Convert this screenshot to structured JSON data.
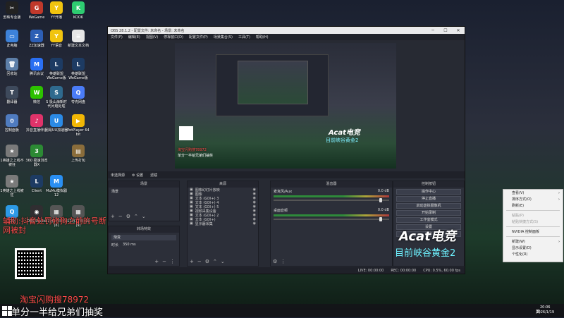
{
  "desktop": {
    "icons": [
      {
        "label": "剪映专业版",
        "glyph": "✂",
        "color": "#222222",
        "name": "capcut-icon"
      },
      {
        "label": "WeGame",
        "glyph": "G",
        "color": "#c0392b",
        "name": "wegame-icon"
      },
      {
        "label": "YY开播",
        "glyph": "Y",
        "color": "#f1c40f",
        "name": "yy-live-icon"
      },
      {
        "label": "KOOK",
        "glyph": "K",
        "color": "#2ecc71",
        "name": "kook-icon"
      },
      {
        "label": "此电脑",
        "glyph": "▭",
        "color": "#3d82d9",
        "name": "this-pc-icon"
      },
      {
        "label": "ZZ加速器",
        "glyph": "Z",
        "color": "#2d5fb5",
        "name": "zz-accelerator-icon"
      },
      {
        "label": "YY语音",
        "glyph": "Y",
        "color": "#f1c40f",
        "name": "yy-voice-icon"
      },
      {
        "label": "新建文本文档",
        "glyph": "≡",
        "color": "#e6e6e6",
        "name": "text-doc-icon"
      },
      {
        "label": "回收站",
        "glyph": "🗑",
        "color": "#5d7fa8",
        "name": "recycle-bin-icon"
      },
      {
        "label": "腾讯会议",
        "glyph": "M",
        "color": "#2a6ff2",
        "name": "tencent-meeting-icon"
      },
      {
        "label": "英雄联盟WeGame版",
        "glyph": "L",
        "color": "#1d3b63",
        "name": "lol-wegame-icon"
      },
      {
        "label": "英雄联盟WeGame版",
        "glyph": "L",
        "color": "#1d3b63",
        "name": "lol-wegame-2-icon"
      },
      {
        "label": "翻译器",
        "glyph": "T",
        "color": "#3e4a5c",
        "name": "translator-icon"
      },
      {
        "label": "微信",
        "glyph": "W",
        "color": "#2dc100",
        "name": "wechat-icon"
      },
      {
        "label": "S 极山海新时代问题处理",
        "glyph": "S",
        "color": "#2f6a8e",
        "name": "doc-icon"
      },
      {
        "label": "夸克网盘",
        "glyph": "Q",
        "color": "#4a7cf7",
        "name": "quark-icon"
      },
      {
        "label": "控制面板",
        "glyph": "⚙",
        "color": "#4f7bbf",
        "name": "control-panel-icon"
      },
      {
        "label": "抖音直播伴侣",
        "glyph": "♪",
        "color": "#e0336a",
        "name": "douyin-icon"
      },
      {
        "label": "网易UU加速器",
        "glyph": "U",
        "color": "#2b8ae6",
        "name": "uu-icon"
      },
      {
        "label": "PotPlayer 64 bit",
        "glyph": "▶",
        "color": "#f2b705",
        "name": "potplayer-icon"
      },
      {
        "label": "1英雄之上线不被狂",
        "glyph": "★",
        "color": "#7a7a7a",
        "name": "shortcut-icon"
      },
      {
        "label": "360 极速浏览器X",
        "glyph": "3",
        "color": "#2c8a34",
        "name": "360-icon"
      },
      {
        "label": "",
        "glyph": "",
        "color": "#333333",
        "name": "blank-icon"
      },
      {
        "label": "上传打包",
        "glyph": "▤",
        "color": "#8a6d3b",
        "name": "folder-icon"
      },
      {
        "label": "1英雄之上线被狂",
        "glyph": "★",
        "color": "#7a7a7a",
        "name": "shortcut-2-icon"
      },
      {
        "label": "Client",
        "glyph": "L",
        "color": "#1d3b63",
        "name": "lol-client-icon"
      },
      {
        "label": "MuMu模拟器12",
        "glyph": "M",
        "color": "#2a8ff2",
        "name": "mumu-icon"
      },
      {
        "label": "",
        "glyph": "",
        "color": "#333333",
        "name": "blank-2-icon"
      },
      {
        "label": "QQ",
        "glyph": "Q",
        "color": "#2d9ae6",
        "name": "qq-icon"
      },
      {
        "label": "OBS Studio",
        "glyph": "◉",
        "color": "#302e31",
        "name": "obs-icon"
      },
      {
        "label": "12月17日 (1)(8)",
        "glyph": "▦",
        "color": "#555555",
        "name": "video-file-icon"
      },
      {
        "label": "12月17日 (1)(9)",
        "glyph": "▦",
        "color": "#555555",
        "name": "video-file-2-icon"
      }
    ]
  },
  "obs": {
    "title": "OBS 28.1.2 - 配置文件: 未命名 - 场景: 未命名",
    "menu": [
      "文件(F)",
      "编辑(E)",
      "视图(V)",
      "停靠窗口(D)",
      "配置文件(P)",
      "场景集合(S)",
      "工具(T)",
      "帮助(H)"
    ],
    "dockbar": [
      "未选择源",
      "⚙ 设置",
      "滤镜"
    ],
    "scenes": {
      "header": "场景",
      "items": [
        "场景"
      ]
    },
    "transitions": {
      "header": "转场特效",
      "type": "渐变",
      "duration_label": "时长",
      "duration": "350 ms"
    },
    "sources": {
      "header": "来源",
      "items": [
        "图像幻灯片放映",
        "图像",
        "文本 (GDI+) 3",
        "文本 (GDI+) 4",
        "文本 (GDI+) 5",
        "视频采集设备",
        "文本 (GDI+) 2",
        "文本 (GDI+)",
        "显示器采集"
      ]
    },
    "mixer": {
      "header": "混音器",
      "channels": [
        {
          "name": "麦克风/Aux",
          "db": "0.0 dB"
        },
        {
          "name": "桌面音频",
          "db": "0.0 dB"
        }
      ]
    },
    "controls": {
      "header": "控制按钮",
      "buttons": [
        "操作中心",
        "停止直播",
        "启动虚拟摄像机",
        "开始录制",
        "工作室模式",
        "设置",
        "退出"
      ]
    },
    "status": {
      "live": "LIVE: 00:00:00",
      "rec": "REC: 00:00:00",
      "cpu": "CPU: 0.5%, 60.00 fps"
    },
    "preview": {
      "acat": "Acat电竞",
      "rank": "目前峡谷黄金2",
      "taobao": "淘宝闪购搜78972",
      "notice": "单分一半给兄弟们抽奖"
    }
  },
  "overlay": {
    "acat": "Acat电竞",
    "rank": "目前峡谷黄金2",
    "left_red": "辅助:抖音处罚修狗之前的号断网被封",
    "taobao": "淘宝闪购搜78972",
    "bottom": "单分一半给兄弟们抽奖"
  },
  "context_menu": {
    "items": [
      {
        "label": "查看(V)",
        "submenu": true,
        "disabled": false
      },
      {
        "label": "排序方式(O)",
        "submenu": true,
        "disabled": false
      },
      {
        "label": "刷新(E)",
        "submenu": false,
        "disabled": false
      },
      {
        "label": "粘贴(P)",
        "submenu": false,
        "disabled": true
      },
      {
        "label": "粘贴快捷方式(S)",
        "submenu": false,
        "disabled": true
      },
      {
        "label": "NVIDIA 控制面板",
        "submenu": false,
        "disabled": false
      },
      {
        "label": "新建(W)",
        "submenu": true,
        "disabled": false
      },
      {
        "label": "显示设置(D)",
        "submenu": false,
        "disabled": false
      },
      {
        "label": "个性化(R)",
        "submenu": false,
        "disabled": false
      }
    ]
  },
  "taskbar": {
    "ime": "英",
    "time": "20:06",
    "date": "2026/1/19"
  }
}
